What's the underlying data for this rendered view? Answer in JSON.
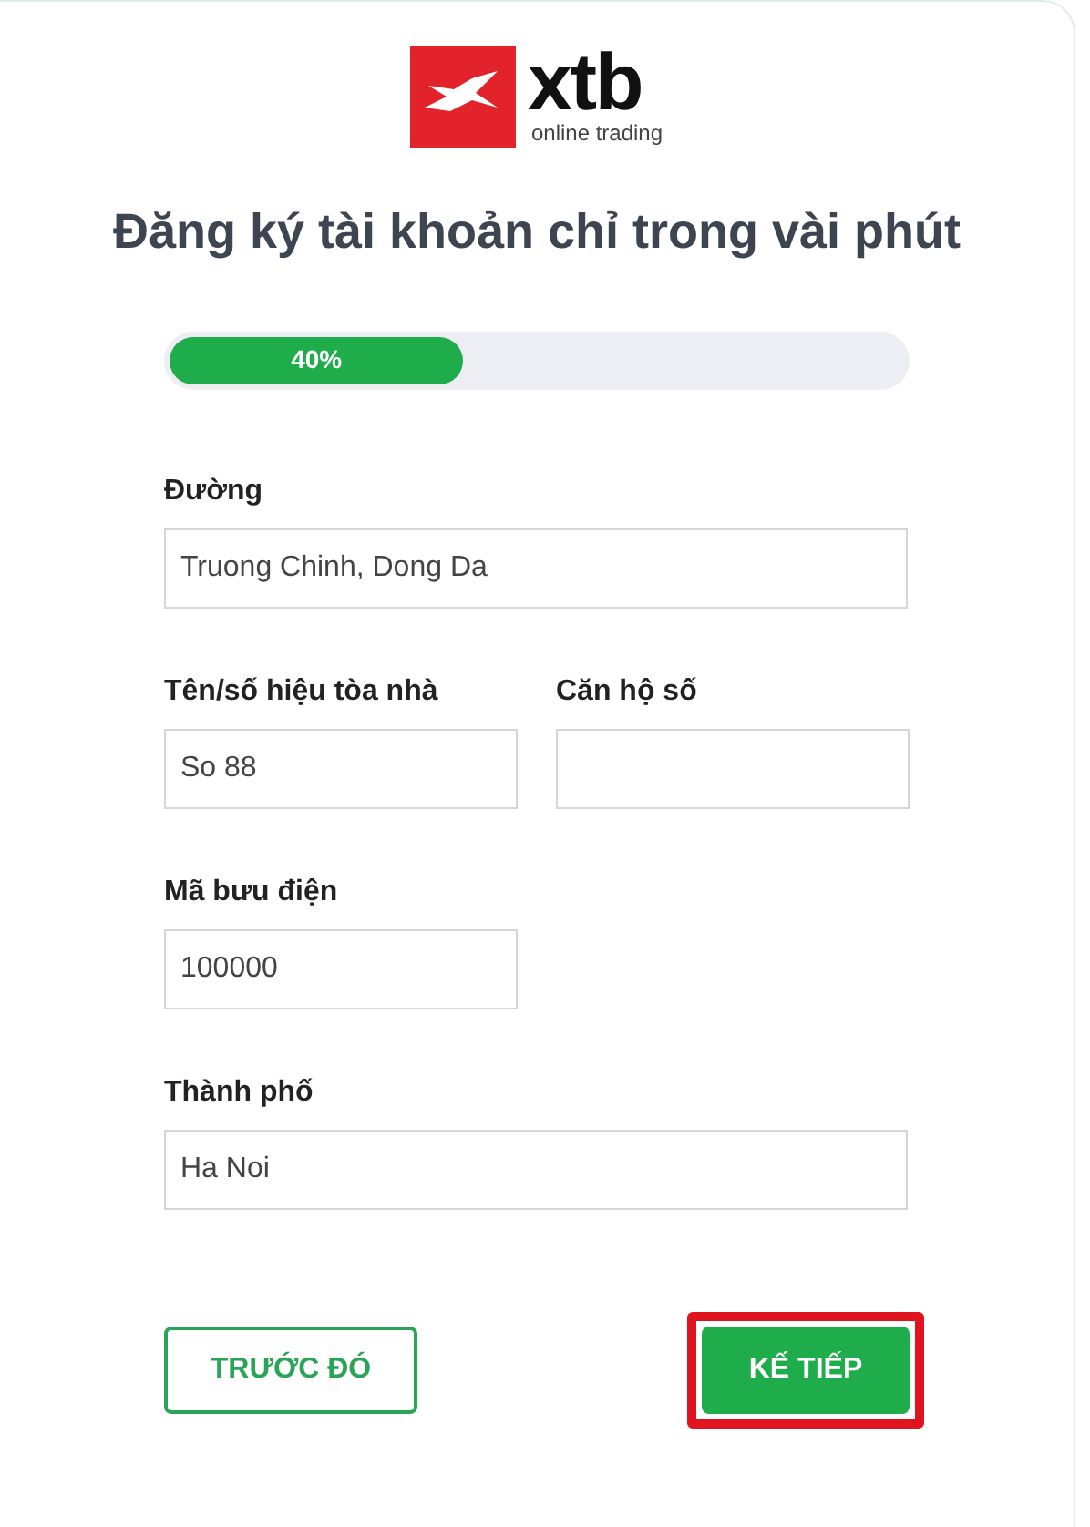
{
  "logo": {
    "wordmark": "xtb",
    "tagline": "online trading"
  },
  "title": "Đăng ký tài khoản chỉ trong vài phút",
  "progress": {
    "level": 0.4,
    "label": "40%"
  },
  "form_rows": [
    [
      {
        "label": "Đường",
        "value": "Truong Chinh, Dong Da",
        "kind": "wide"
      }
    ],
    [
      {
        "label": "Tên/số hiệu tòa nhà",
        "value": "So 88",
        "kind": "narrow"
      },
      {
        "label": "Căn hộ số",
        "kind": "narrow"
      }
    ],
    [
      {
        "label": "Mã bưu điện",
        "value": "100000",
        "kind": "narrow"
      }
    ],
    [
      {
        "label": "Thành phố",
        "value": "Ha Noi",
        "kind": "wide"
      }
    ]
  ],
  "buttons": [
    {
      "label": "TRƯỚC ĐÓ",
      "kind": "secondary",
      "highlighted": false
    },
    {
      "label": "KẾ TIẾP",
      "kind": "primary",
      "highlighted": true
    }
  ]
}
